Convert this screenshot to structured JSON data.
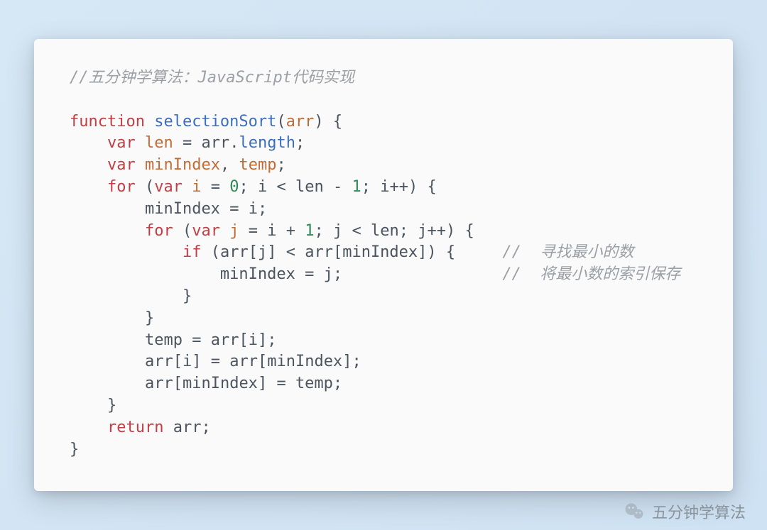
{
  "code": {
    "title_comment": "//五分钟学算法：JavaScript代码实现",
    "fn_keyword": "function",
    "fn_name": "selectionSort",
    "param": "arr",
    "var_kw": "var",
    "for_kw": "for",
    "if_kw": "if",
    "return_kw": "return",
    "len_ident": "len",
    "length_prop": "length",
    "minIndex_ident": "minIndex",
    "temp_ident": "temp",
    "i_ident": "i",
    "j_ident": "j",
    "num_zero": "0",
    "num_one": "1",
    "inline_comment_find": "//  寻找最小的数",
    "inline_comment_save": "//  将最小数的索引保存"
  },
  "watermark": {
    "text": "五分钟学算法"
  }
}
